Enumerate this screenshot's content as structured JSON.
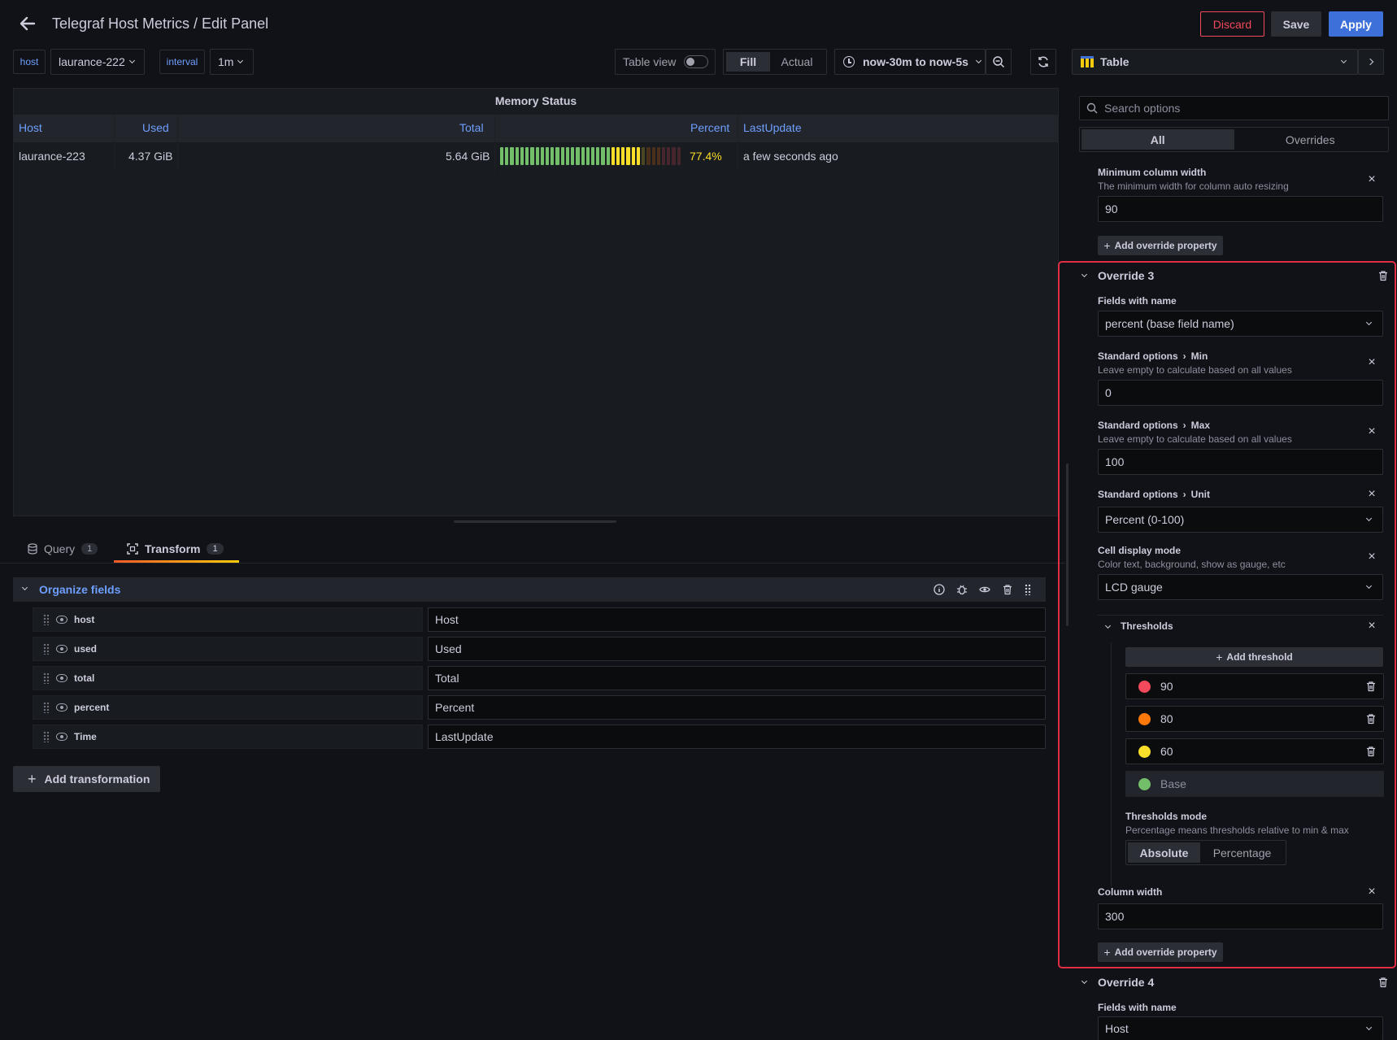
{
  "header": {
    "title": "Telegraf Host Metrics / Edit Panel",
    "discard": "Discard",
    "save": "Save",
    "apply": "Apply"
  },
  "variables": {
    "host_label": "host",
    "host_value": "laurance-222",
    "interval_label": "interval",
    "interval_value": "1m"
  },
  "toolbar": {
    "table_view": "Table view",
    "fill": "Fill",
    "actual": "Actual",
    "time_range": "now-30m to now-5s",
    "visualization": "Table"
  },
  "panel": {
    "title": "Memory Status",
    "columns": [
      "Host",
      "Used",
      "Total",
      "Percent",
      "LastUpdate"
    ],
    "row": {
      "host": "laurance-223",
      "used": "4.37 GiB",
      "total": "5.64 GiB",
      "percent_text": "77.4%",
      "percent_value": 77.4,
      "last_update": "a few seconds ago"
    }
  },
  "tabs": {
    "query": "Query",
    "query_count": "1",
    "transform": "Transform",
    "transform_count": "1"
  },
  "transform": {
    "title": "Organize fields",
    "fields": [
      {
        "name": "host",
        "alias": "Host"
      },
      {
        "name": "used",
        "alias": "Used"
      },
      {
        "name": "total",
        "alias": "Total"
      },
      {
        "name": "percent",
        "alias": "Percent"
      },
      {
        "name": "Time",
        "alias": "LastUpdate"
      }
    ],
    "add_button": "Add transformation"
  },
  "options": {
    "search_placeholder": "Search options",
    "tab_all": "All",
    "tab_overrides": "Overrides",
    "min_col_width": {
      "label": "Minimum column width",
      "desc": "The minimum width for column auto resizing",
      "value": "90"
    },
    "add_override_property": "Add override property",
    "override3": {
      "title": "Override 3",
      "matcher_label": "Fields with name",
      "matcher_value": "percent (base field name)",
      "min": {
        "group": "Standard options",
        "name": "Min",
        "desc": "Leave empty to calculate based on all values",
        "value": "0"
      },
      "max": {
        "group": "Standard options",
        "name": "Max",
        "desc": "Leave empty to calculate based on all values",
        "value": "100"
      },
      "unit": {
        "group": "Standard options",
        "name": "Unit",
        "value": "Percent (0-100)"
      },
      "cell_display": {
        "label": "Cell display mode",
        "desc": "Color text, background, show as gauge, etc",
        "value": "LCD gauge"
      },
      "thresholds": {
        "label": "Thresholds",
        "add": "Add threshold",
        "steps": [
          {
            "value": "90",
            "color": "#f2495c"
          },
          {
            "value": "80",
            "color": "#ff780a"
          },
          {
            "value": "60",
            "color": "#fade2a"
          },
          {
            "value": "Base",
            "color": "#73bf69"
          }
        ],
        "mode_label": "Thresholds mode",
        "mode_desc": "Percentage means thresholds relative to min & max",
        "absolute": "Absolute",
        "percentage": "Percentage"
      },
      "column_width": {
        "label": "Column width",
        "value": "300"
      }
    },
    "override4": {
      "title": "Override 4",
      "matcher_label": "Fields with name",
      "matcher_value": "Host"
    }
  },
  "colors": {
    "accent_blue": "#3d71d9",
    "link_blue": "#6e9fff",
    "discard_red": "#f2495c",
    "highlight_red": "#e02f44"
  }
}
